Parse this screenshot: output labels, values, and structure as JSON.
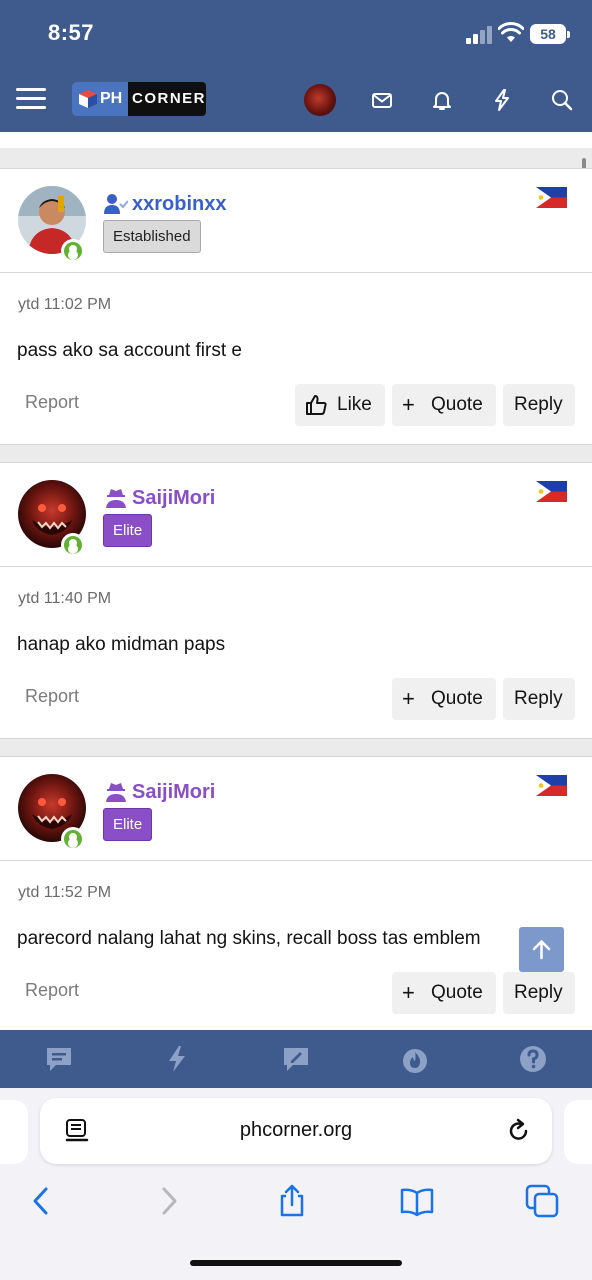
{
  "status_bar": {
    "time": "8:57",
    "battery": "58"
  },
  "header": {
    "logo_ph": "PH",
    "logo_corner": "CORNER"
  },
  "posts": [
    {
      "username": "xxrobinxx",
      "name_color": "#3b5fc9",
      "badge": "Established",
      "time": "ytd 11:02 PM",
      "text": "pass ako sa account first e",
      "report": "Report",
      "actions": [
        "Like",
        "Quote",
        "Reply"
      ]
    },
    {
      "username": "SaijiMori",
      "name_color": "#8a4fc7",
      "badge": "Elite",
      "time": "ytd 11:40 PM",
      "text": "hanap ako midman paps",
      "report": "Report",
      "actions": [
        "Quote",
        "Reply"
      ]
    },
    {
      "username": "SaijiMori",
      "name_color": "#8a4fc7",
      "badge": "Elite",
      "time": "ytd 11:52 PM",
      "text": "parecord nalang lahat ng skins, recall boss tas emblem",
      "report": "Report",
      "actions": [
        "Quote",
        "Reply"
      ]
    }
  ],
  "site_nav": {
    "items": [
      "chat-icon",
      "lightning-icon",
      "edit-icon",
      "fire-icon",
      "help-icon"
    ]
  },
  "browser": {
    "url": "phcorner.org"
  },
  "colors": {
    "header_bg": "#3f5b8e",
    "accent": "#4a74bf",
    "online": "#63b132"
  }
}
